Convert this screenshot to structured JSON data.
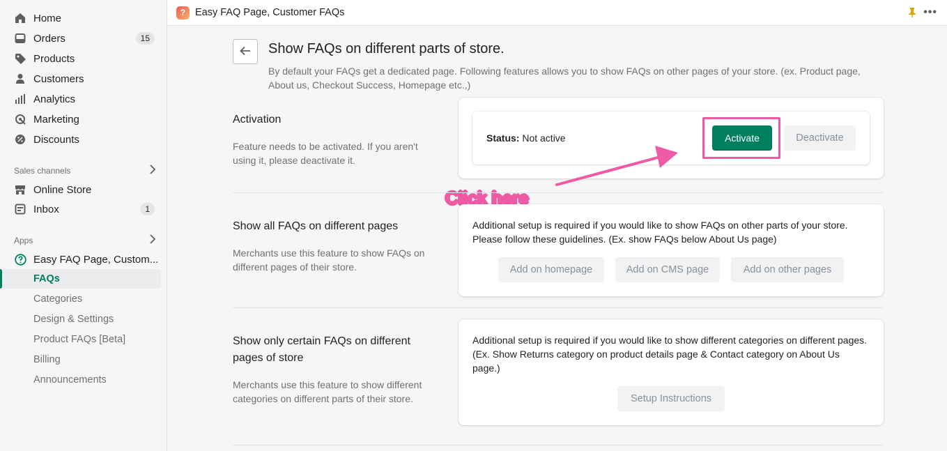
{
  "sidebar": {
    "items": [
      {
        "label": "Home",
        "icon": "home-icon"
      },
      {
        "label": "Orders",
        "icon": "orders-icon",
        "badge": "15"
      },
      {
        "label": "Products",
        "icon": "tag-icon"
      },
      {
        "label": "Customers",
        "icon": "person-icon"
      },
      {
        "label": "Analytics",
        "icon": "bar-chart-icon"
      },
      {
        "label": "Marketing",
        "icon": "marketing-icon"
      },
      {
        "label": "Discounts",
        "icon": "discount-icon"
      }
    ],
    "sales_channels_label": "Sales channels",
    "channels": [
      {
        "label": "Online Store",
        "icon": "store-icon"
      },
      {
        "label": "Inbox",
        "icon": "inbox-icon",
        "badge": "1"
      }
    ],
    "apps_label": "Apps",
    "app_name": "Easy FAQ Page, Custom...",
    "app_subitems": [
      "FAQs",
      "Categories",
      "Design & Settings",
      "Product FAQs [Beta]",
      "Billing",
      "Announcements"
    ],
    "active_subitem": "FAQs"
  },
  "topbar": {
    "title": "Easy FAQ Page, Customer FAQs"
  },
  "page": {
    "title": "Show FAQs on different parts of store.",
    "subtitle": "By default your FAQs get a dedicated page. Following features allows you to show FAQs on other pages of your store. (ex. Product page, About us, Checkout Success, Homepage etc.,)"
  },
  "activation": {
    "title": "Activation",
    "description": "Feature needs to be activated. If you aren't using it, please deactivate it.",
    "status_label": "Status:",
    "status_value": "Not active",
    "activate_label": "Activate",
    "deactivate_label": "Deactivate"
  },
  "annotation": {
    "text": "Click here",
    "color": "#ef5aa4"
  },
  "all_faqs": {
    "title": "Show all FAQs on different pages",
    "description": "Merchants use this feature to show FAQs on different pages of their store.",
    "card_text": "Additional setup is required if you would like to show FAQs on other parts of your store. Please follow these guidelines. (Ex. show FAQs below About Us page)",
    "buttons": [
      "Add on homepage",
      "Add on CMS page",
      "Add on other pages"
    ]
  },
  "certain_faqs": {
    "title": "Show only certain FAQs on different pages of store",
    "description": "Merchants use this feature to show different categories on different parts of their store.",
    "card_text": "Additional setup is required if you would like to show different categories on different pages. (Ex. Show Returns category on product details page & Contact category on About Us page.)",
    "button": "Setup Instructions"
  },
  "colors": {
    "primary": "#007f5f",
    "highlight": "#ef5aa4"
  }
}
